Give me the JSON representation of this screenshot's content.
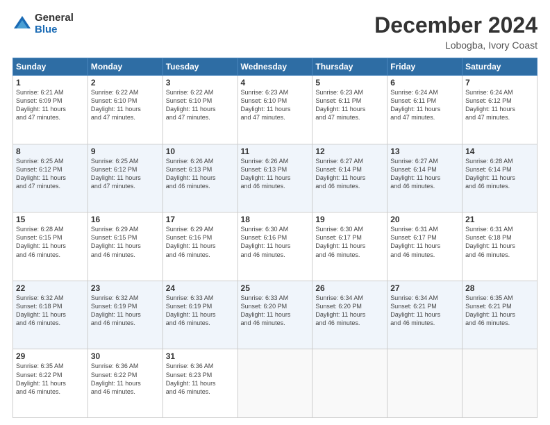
{
  "logo": {
    "general": "General",
    "blue": "Blue"
  },
  "header": {
    "title": "December 2024",
    "subtitle": "Lobogba, Ivory Coast"
  },
  "calendar": {
    "days_of_week": [
      "Sunday",
      "Monday",
      "Tuesday",
      "Wednesday",
      "Thursday",
      "Friday",
      "Saturday"
    ],
    "weeks": [
      [
        {
          "day": "1",
          "info": "Sunrise: 6:21 AM\nSunset: 6:09 PM\nDaylight: 11 hours\nand 47 minutes."
        },
        {
          "day": "2",
          "info": "Sunrise: 6:22 AM\nSunset: 6:10 PM\nDaylight: 11 hours\nand 47 minutes."
        },
        {
          "day": "3",
          "info": "Sunrise: 6:22 AM\nSunset: 6:10 PM\nDaylight: 11 hours\nand 47 minutes."
        },
        {
          "day": "4",
          "info": "Sunrise: 6:23 AM\nSunset: 6:10 PM\nDaylight: 11 hours\nand 47 minutes."
        },
        {
          "day": "5",
          "info": "Sunrise: 6:23 AM\nSunset: 6:11 PM\nDaylight: 11 hours\nand 47 minutes."
        },
        {
          "day": "6",
          "info": "Sunrise: 6:24 AM\nSunset: 6:11 PM\nDaylight: 11 hours\nand 47 minutes."
        },
        {
          "day": "7",
          "info": "Sunrise: 6:24 AM\nSunset: 6:12 PM\nDaylight: 11 hours\nand 47 minutes."
        }
      ],
      [
        {
          "day": "8",
          "info": "Sunrise: 6:25 AM\nSunset: 6:12 PM\nDaylight: 11 hours\nand 47 minutes."
        },
        {
          "day": "9",
          "info": "Sunrise: 6:25 AM\nSunset: 6:12 PM\nDaylight: 11 hours\nand 47 minutes."
        },
        {
          "day": "10",
          "info": "Sunrise: 6:26 AM\nSunset: 6:13 PM\nDaylight: 11 hours\nand 46 minutes."
        },
        {
          "day": "11",
          "info": "Sunrise: 6:26 AM\nSunset: 6:13 PM\nDaylight: 11 hours\nand 46 minutes."
        },
        {
          "day": "12",
          "info": "Sunrise: 6:27 AM\nSunset: 6:14 PM\nDaylight: 11 hours\nand 46 minutes."
        },
        {
          "day": "13",
          "info": "Sunrise: 6:27 AM\nSunset: 6:14 PM\nDaylight: 11 hours\nand 46 minutes."
        },
        {
          "day": "14",
          "info": "Sunrise: 6:28 AM\nSunset: 6:14 PM\nDaylight: 11 hours\nand 46 minutes."
        }
      ],
      [
        {
          "day": "15",
          "info": "Sunrise: 6:28 AM\nSunset: 6:15 PM\nDaylight: 11 hours\nand 46 minutes."
        },
        {
          "day": "16",
          "info": "Sunrise: 6:29 AM\nSunset: 6:15 PM\nDaylight: 11 hours\nand 46 minutes."
        },
        {
          "day": "17",
          "info": "Sunrise: 6:29 AM\nSunset: 6:16 PM\nDaylight: 11 hours\nand 46 minutes."
        },
        {
          "day": "18",
          "info": "Sunrise: 6:30 AM\nSunset: 6:16 PM\nDaylight: 11 hours\nand 46 minutes."
        },
        {
          "day": "19",
          "info": "Sunrise: 6:30 AM\nSunset: 6:17 PM\nDaylight: 11 hours\nand 46 minutes."
        },
        {
          "day": "20",
          "info": "Sunrise: 6:31 AM\nSunset: 6:17 PM\nDaylight: 11 hours\nand 46 minutes."
        },
        {
          "day": "21",
          "info": "Sunrise: 6:31 AM\nSunset: 6:18 PM\nDaylight: 11 hours\nand 46 minutes."
        }
      ],
      [
        {
          "day": "22",
          "info": "Sunrise: 6:32 AM\nSunset: 6:18 PM\nDaylight: 11 hours\nand 46 minutes."
        },
        {
          "day": "23",
          "info": "Sunrise: 6:32 AM\nSunset: 6:19 PM\nDaylight: 11 hours\nand 46 minutes."
        },
        {
          "day": "24",
          "info": "Sunrise: 6:33 AM\nSunset: 6:19 PM\nDaylight: 11 hours\nand 46 minutes."
        },
        {
          "day": "25",
          "info": "Sunrise: 6:33 AM\nSunset: 6:20 PM\nDaylight: 11 hours\nand 46 minutes."
        },
        {
          "day": "26",
          "info": "Sunrise: 6:34 AM\nSunset: 6:20 PM\nDaylight: 11 hours\nand 46 minutes."
        },
        {
          "day": "27",
          "info": "Sunrise: 6:34 AM\nSunset: 6:21 PM\nDaylight: 11 hours\nand 46 minutes."
        },
        {
          "day": "28",
          "info": "Sunrise: 6:35 AM\nSunset: 6:21 PM\nDaylight: 11 hours\nand 46 minutes."
        }
      ],
      [
        {
          "day": "29",
          "info": "Sunrise: 6:35 AM\nSunset: 6:22 PM\nDaylight: 11 hours\nand 46 minutes."
        },
        {
          "day": "30",
          "info": "Sunrise: 6:36 AM\nSunset: 6:22 PM\nDaylight: 11 hours\nand 46 minutes."
        },
        {
          "day": "31",
          "info": "Sunrise: 6:36 AM\nSunset: 6:23 PM\nDaylight: 11 hours\nand 46 minutes."
        },
        {
          "day": "",
          "info": ""
        },
        {
          "day": "",
          "info": ""
        },
        {
          "day": "",
          "info": ""
        },
        {
          "day": "",
          "info": ""
        }
      ]
    ]
  }
}
